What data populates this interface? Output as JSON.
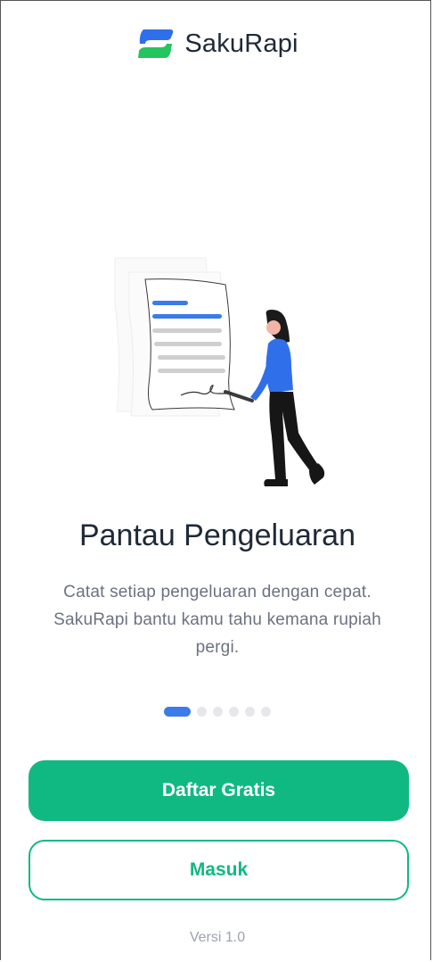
{
  "header": {
    "app_name": "SakuRapi",
    "logo_icon": "sakurapi-logo-icon"
  },
  "onboarding": {
    "illustration": "woman-signing-document-illustration",
    "title": "Pantau Pengeluaran",
    "description": "Catat setiap pengeluaran dengan cepat. SakuRapi bantu kamu tahu kemana rupiah pergi.",
    "pagination": {
      "total": 6,
      "active_index": 0
    }
  },
  "actions": {
    "register_label": "Daftar Gratis",
    "login_label": "Masuk"
  },
  "footer": {
    "version": "Versi 1.0"
  },
  "colors": {
    "primary": "#10b981",
    "accent_blue": "#3b7bea",
    "text_dark": "#1f2937",
    "text_muted": "#6b7280"
  }
}
